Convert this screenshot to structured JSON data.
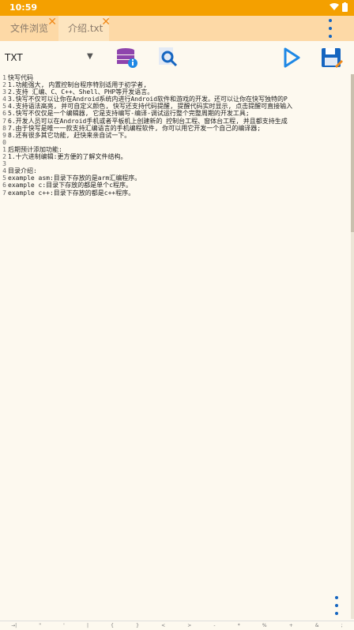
{
  "status": {
    "time": "10:59"
  },
  "tabs": [
    {
      "label": "文件浏览",
      "close": "✕"
    },
    {
      "label": "介绍.txt",
      "close": "✕"
    }
  ],
  "toolbar": {
    "language": "TXT"
  },
  "editor": {
    "line_numbers": [
      "1",
      "2",
      "3",
      "4",
      "5",
      "6",
      "7",
      "8",
      "9",
      "0",
      "1",
      "2",
      "3",
      "4",
      "5",
      "6",
      "7"
    ],
    "lines": [
      "快写代码",
      "1.功能强大, 内置控制台程序特别适用于初学者,",
      "2.支持 汇编、C、C++、Shell、PHP等开发语言。",
      "3.快写不仅可以让你在Android系统内进行Android软件和游戏的开发。还可以让你在快写独特的P",
      "4.支持语法高亮, 并可自定义颜色, 快写还支持代码提醒, 提醒代码实时显示, 点击提醒可直接输入",
      "5.快写不仅仅是一个编辑器, 它是支持编写-编译-调试运行整个完整周期的开发工具;",
      "6.开发人员可以在Android手机或者平板机上创建新的 控制台工程、窗体台工程, 并且都支持生成",
      "7.由于快写是唯一一款支持汇编语言的手机编程软件, 你可以用它开发一个自己的编译器;",
      "8.还有很多其它功能, 赶快来亲自试一下。",
      "",
      "后期预计添加功能:",
      "1.十六进制编辑:更方便的了解文件结构。",
      "",
      "目录介绍:",
      "example asm:目录下存放的是arm汇编程序。",
      "example c:目录下存放的都是单个c程序。",
      "example c++:目录下存放的都是c++程序。"
    ]
  },
  "symbols": [
    "→|",
    "\"",
    "'",
    "|",
    "{",
    "}",
    "<",
    ">",
    "-",
    "*",
    "%",
    "+",
    "&",
    ";"
  ]
}
